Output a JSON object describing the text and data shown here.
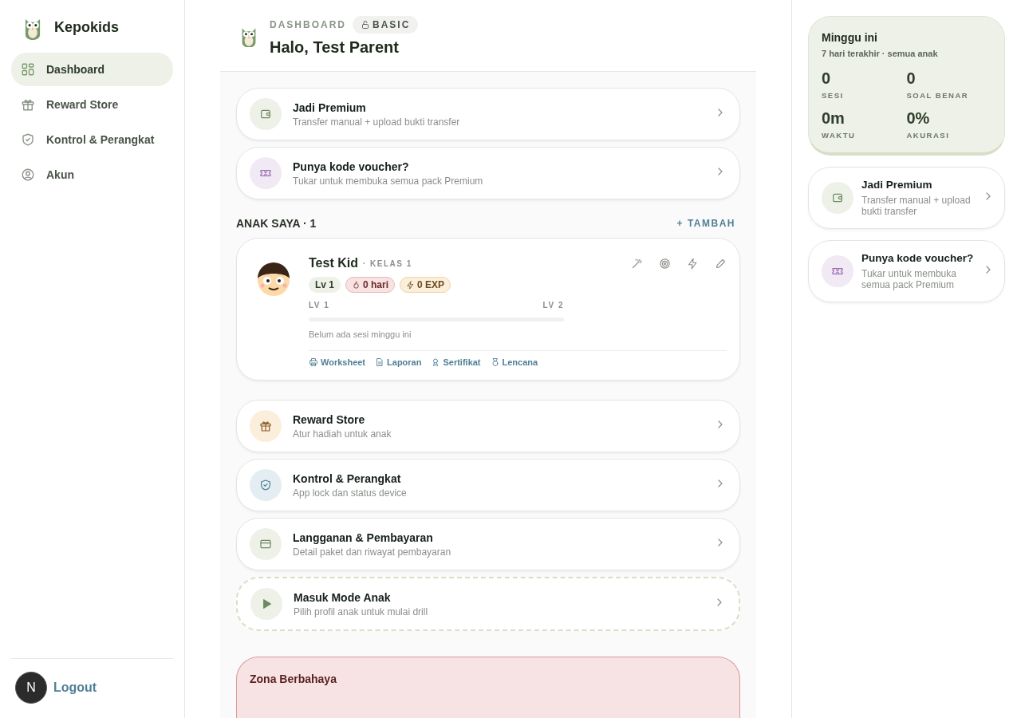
{
  "brand": {
    "name": "Kepokids"
  },
  "sidebar": {
    "items": [
      {
        "label": "Dashboard",
        "selected": true
      },
      {
        "label": "Reward Store",
        "selected": false
      },
      {
        "label": "Kontrol & Perangkat",
        "selected": false
      },
      {
        "label": "Akun",
        "selected": false
      }
    ],
    "logout": "Logout",
    "dev_badge": "N"
  },
  "header": {
    "eyebrow": "DASHBOARD",
    "plan": "BASIC",
    "title": "Halo, Test Parent"
  },
  "promo_cards": [
    {
      "kind": "premium",
      "title": "Jadi Premium",
      "subtitle": "Transfer manual + upload bukti transfer"
    },
    {
      "kind": "voucher",
      "title": "Punya kode voucher?",
      "subtitle": "Tukar untuk membuka semua pack Premium"
    }
  ],
  "children_section": {
    "title": "ANAK SAYA · 1",
    "add": "+ TAMBAH"
  },
  "children": [
    {
      "name": "Test Kid",
      "grade": "· KELAS 1",
      "level_badge": "Lv 1",
      "streak": "0 hari",
      "exp": "0 EXP",
      "level_from": "LV 1",
      "level_to": "LV 2",
      "level": 0,
      "note": "Belum ada sesi minggu ini",
      "links": [
        "Worksheet",
        "Laporan",
        "Sertifikat",
        "Lencana"
      ]
    }
  ],
  "menu_cards": [
    {
      "kind": "reward",
      "title": "Reward Store",
      "subtitle": "Atur hadiah untuk anak"
    },
    {
      "kind": "device",
      "title": "Kontrol & Perangkat",
      "subtitle": "App lock dan status device"
    },
    {
      "kind": "billing",
      "title": "Langganan & Pembayaran",
      "subtitle": "Detail paket dan riwayat pembayaran"
    },
    {
      "kind": "kid_mode",
      "title": "Masuk Mode Anak",
      "subtitle": "Pilih profil anak untuk mulai drill"
    }
  ],
  "danger_zone": {
    "title": "Zona Berbahaya"
  },
  "weekly": {
    "title": "Minggu ini",
    "subtitle": "7 hari terakhir · semua anak",
    "stats": [
      {
        "value": "0",
        "label": "SESI"
      },
      {
        "value": "0",
        "label": "SOAL BENAR"
      },
      {
        "value": "0m",
        "label": "WAKTU"
      },
      {
        "value": "0%",
        "label": "AKURASI"
      }
    ]
  },
  "side_cards": [
    {
      "kind": "premium",
      "title": "Jadi Premium",
      "subtitle": "Transfer manual + upload bukti transfer"
    },
    {
      "kind": "voucher",
      "title": "Punya kode voucher?",
      "subtitle": "Tukar untuk membuka semua pack Premium"
    }
  ]
}
